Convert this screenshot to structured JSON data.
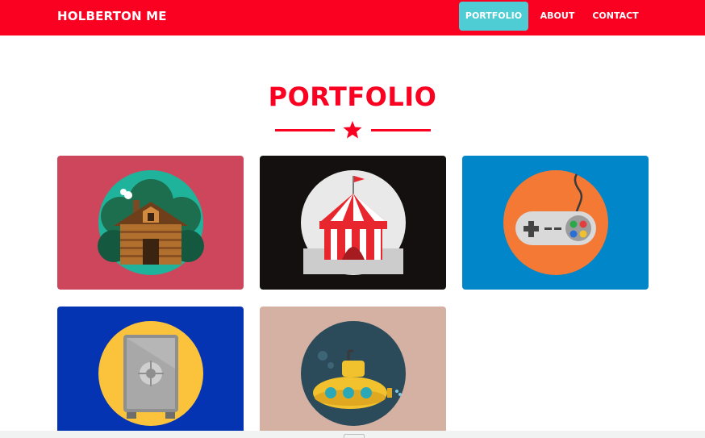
{
  "navbar": {
    "brand": "HOLBERTON ME",
    "items": [
      {
        "label": "PORTFOLIO",
        "active": true
      },
      {
        "label": "ABOUT",
        "active": false
      },
      {
        "label": "CONTACT",
        "active": false
      }
    ]
  },
  "colors": {
    "brand_red": "#fa0021",
    "active_teal": "#4ecdd4"
  },
  "portfolio": {
    "title": "PORTFOLIO",
    "divider_icon": "star-icon",
    "items": [
      {
        "icon": "cabin-icon",
        "background": "#cd465c"
      },
      {
        "icon": "circus-tent-icon",
        "background": "#141010"
      },
      {
        "icon": "game-controller-icon",
        "background": "#0086c9"
      },
      {
        "icon": "safe-icon",
        "background": "#0534b3"
      },
      {
        "icon": "submarine-icon",
        "background": "#d4b1a3"
      }
    ]
  }
}
